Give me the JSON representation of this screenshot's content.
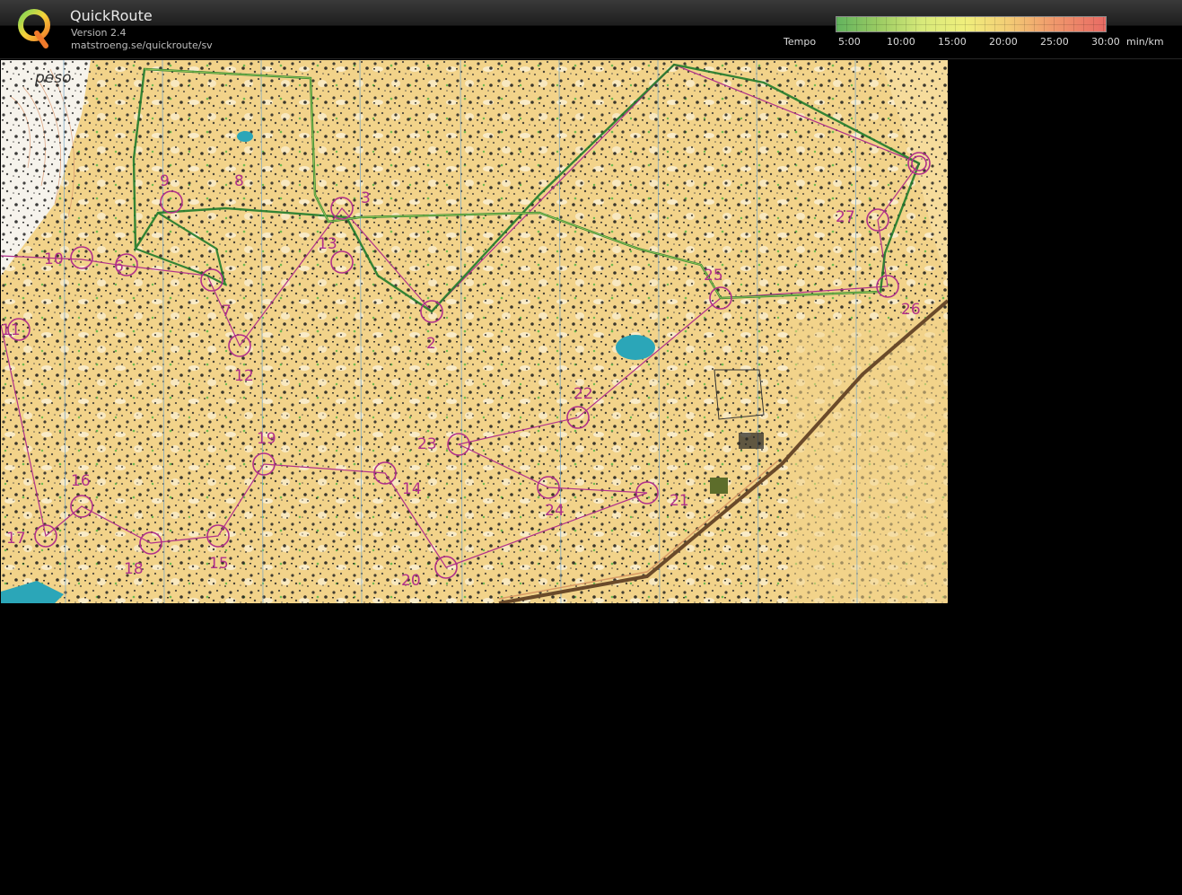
{
  "app": {
    "title": "QuickRoute",
    "version": "Version 2.4",
    "url": "matstroeng.se/quickroute/sv",
    "logo_icon": "quickroute-q-logo-icon"
  },
  "legend": {
    "label": "Tempo",
    "ticks": [
      "5:00",
      "10:00",
      "15:00",
      "20:00",
      "25:00",
      "30:00"
    ],
    "unit": "min/km",
    "colors": [
      "#62b35e",
      "#9ccc63",
      "#d8ea7a",
      "#f0ef7c",
      "#f3cc75",
      "#f09a6c",
      "#e86a64"
    ]
  },
  "map": {
    "text_fragment": "peso",
    "control_labels": [
      "2",
      "3",
      "6",
      "7",
      "8",
      "9",
      "10",
      "11",
      "12",
      "13",
      "14",
      "15",
      "16",
      "17",
      "18",
      "19",
      "20",
      "21",
      "22",
      "23",
      "24",
      "25",
      "26",
      "27"
    ],
    "colors": {
      "terrain": "#f2d38a",
      "course": "#b0308a",
      "route": "#1f7a2a",
      "water": "#2ba6b8"
    }
  }
}
